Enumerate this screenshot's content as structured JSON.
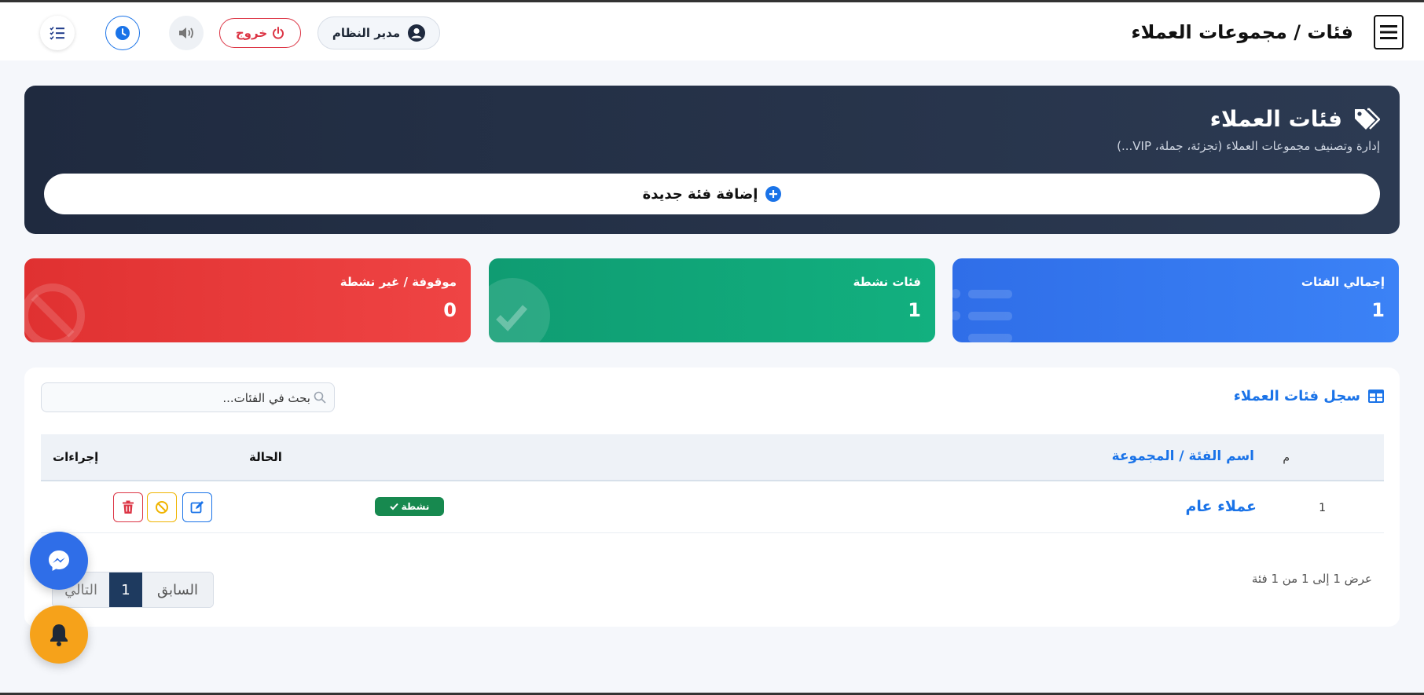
{
  "header": {
    "page_title": "فئات / مجموعات العملاء",
    "user_name": "مدير النظام",
    "logout_label": "خروج"
  },
  "hero": {
    "title": "فئات العملاء",
    "subtitle": "إدارة وتصنيف مجموعات العملاء (تجزئة، جملة، VIP...)",
    "add_button_label": "إضافة فئة جديدة"
  },
  "stats": [
    {
      "label": "إجمالي الفئات",
      "value": "1",
      "color": "#2f6ee8",
      "icon": "list-icon"
    },
    {
      "label": "فئات نشطة",
      "value": "1",
      "color": "#0f9c72",
      "icon": "check-icon"
    },
    {
      "label": "موقوفة / غير نشطة",
      "value": "0",
      "color": "#e03131",
      "icon": "ban-icon"
    }
  ],
  "table": {
    "title": "سجل فئات العملاء",
    "search_placeholder": "بحث في الفئات...",
    "columns": {
      "num": "م",
      "name": "اسم الفئة / المجموعة",
      "status": "الحالة",
      "actions": "إجراءات"
    },
    "rows": [
      {
        "num": "1",
        "name": "عملاء عام",
        "status": "نشطة"
      }
    ],
    "info": "عرض 1 إلى 1 من 1 فئة",
    "pagination": {
      "prev": "السابق",
      "current": "1",
      "next": "التالي"
    }
  },
  "colors": {
    "accent": "#1a73e8",
    "danger": "#dc3545",
    "success": "#17894f",
    "warning": "#f0b400",
    "hero_bg": "#1f2a3f"
  }
}
